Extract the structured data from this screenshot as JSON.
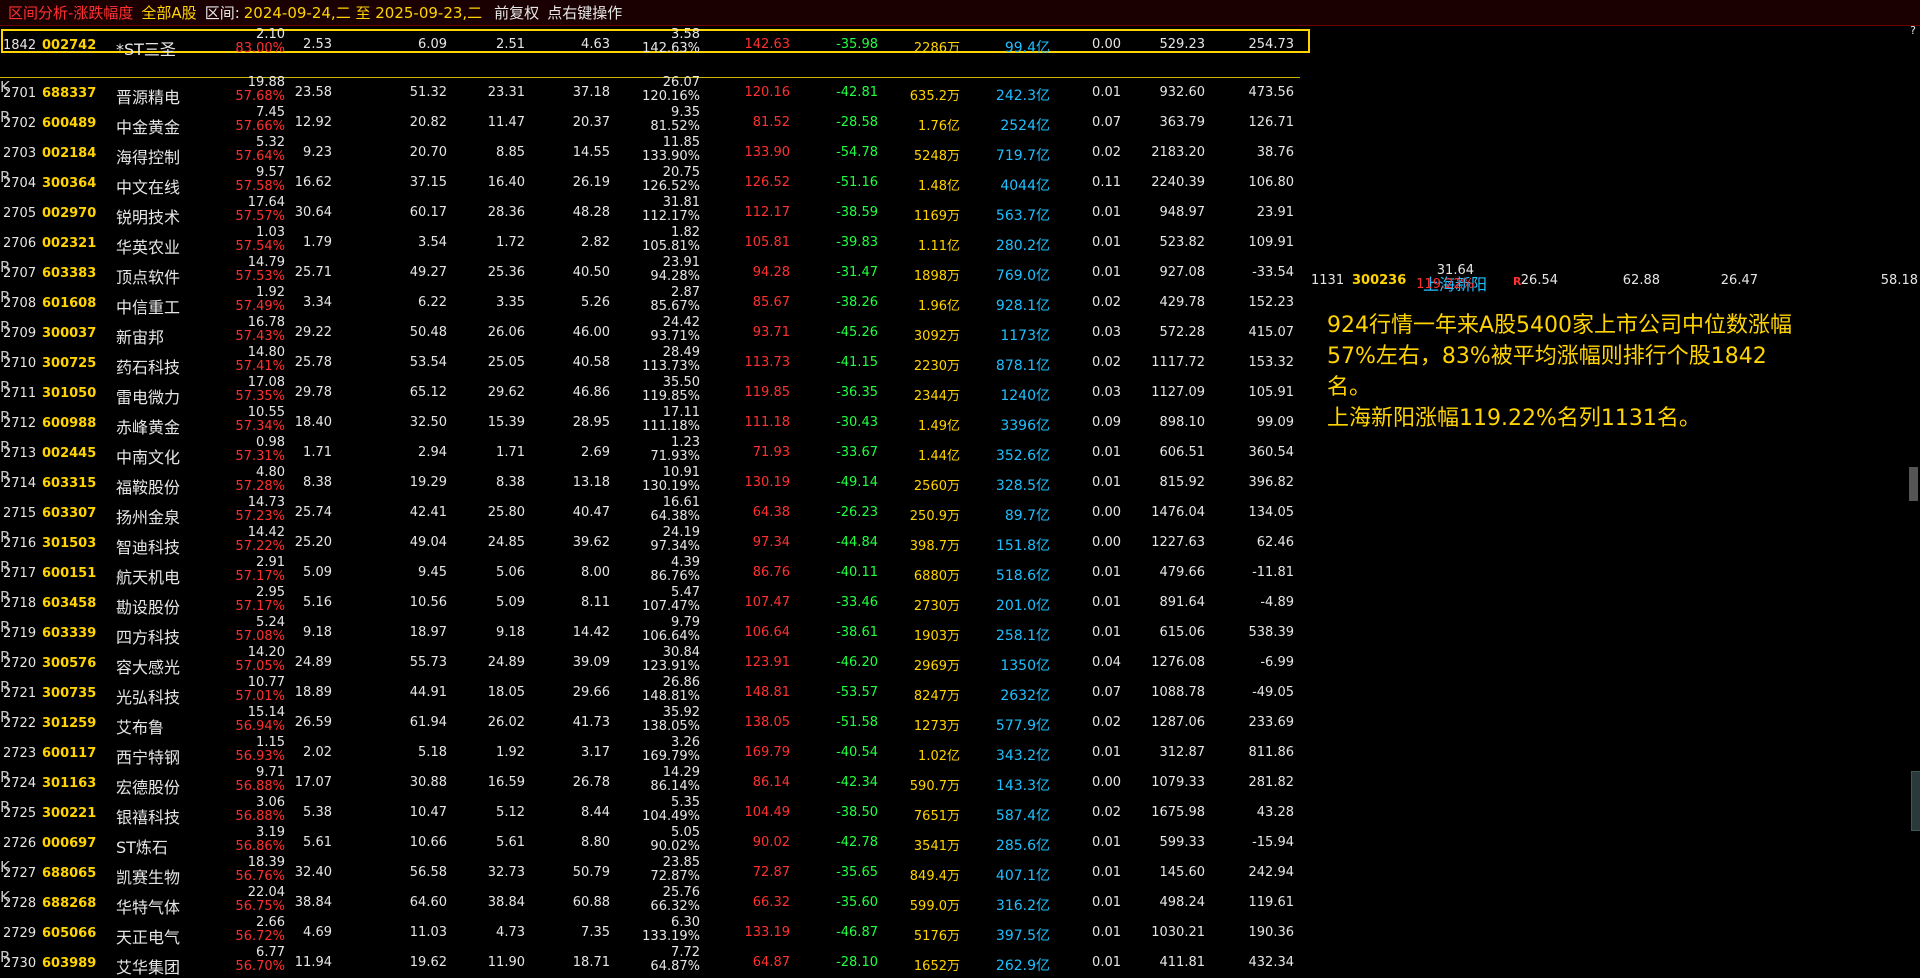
{
  "title": {
    "section": "区间分析-涨跌幅度",
    "market": "全部A股",
    "range_label": "区间:",
    "range": "2024-09-24,二 至 2025-09-23,二",
    "adjust": "前复权",
    "hint": "点右键操作"
  },
  "highlighted": {
    "idx": "1842",
    "code": "002742",
    "name": "*ST三圣",
    "mark": "",
    "p1": "2.10",
    "p1pct": "83.00%",
    "n1": "2.53",
    "n2": "6.09",
    "n3": "2.51",
    "n4": "4.63",
    "p2": "3.58",
    "p2pct": "142.63%",
    "n5": "142.63",
    "n6": "-35.98",
    "n7": "2286万",
    "n8": "99.4亿",
    "n9": "0.00",
    "n10": "529.23",
    "n11": "254.73"
  },
  "rows": [
    {
      "idx": "2701",
      "code": "688337",
      "name": "晋源精电",
      "mark": "K",
      "p1": "19.88",
      "p1pct": "57.68%",
      "n1": "23.58",
      "n2": "51.32",
      "n3": "23.31",
      "n4": "37.18",
      "p2": "26.07",
      "p2pct": "120.16%",
      "n5": "120.16",
      "n6": "-42.81",
      "n7": "635.2万",
      "n8": "242.3亿",
      "n9": "0.01",
      "n10": "932.60",
      "n11": "473.56"
    },
    {
      "idx": "2702",
      "code": "600489",
      "name": "中金黄金",
      "mark": "R",
      "p1": "7.45",
      "p1pct": "57.66%",
      "n1": "12.92",
      "n2": "20.82",
      "n3": "11.47",
      "n4": "20.37",
      "p2": "9.35",
      "p2pct": "81.52%",
      "n5": "81.52",
      "n6": "-28.58",
      "n7": "1.76亿",
      "n8": "2524亿",
      "n9": "0.07",
      "n10": "363.79",
      "n11": "126.71"
    },
    {
      "idx": "2703",
      "code": "002184",
      "name": "海得控制",
      "mark": "",
      "p1": "5.32",
      "p1pct": "57.64%",
      "n1": "9.23",
      "n2": "20.70",
      "n3": "8.85",
      "n4": "14.55",
      "p2": "11.85",
      "p2pct": "133.90%",
      "n5": "133.90",
      "n6": "-54.78",
      "n7": "5248万",
      "n8": "719.7亿",
      "n9": "0.02",
      "n10": "2183.20",
      "n11": "38.76"
    },
    {
      "idx": "2704",
      "code": "300364",
      "name": "中文在线",
      "mark": "R",
      "p1": "9.57",
      "p1pct": "57.58%",
      "n1": "16.62",
      "n2": "37.15",
      "n3": "16.40",
      "n4": "26.19",
      "p2": "20.75",
      "p2pct": "126.52%",
      "n5": "126.52",
      "n6": "-51.16",
      "n7": "1.48亿",
      "n8": "4044亿",
      "n9": "0.11",
      "n10": "2240.39",
      "n11": "106.80"
    },
    {
      "idx": "2705",
      "code": "002970",
      "name": "锐明技术",
      "mark": "",
      "p1": "17.64",
      "p1pct": "57.57%",
      "n1": "30.64",
      "n2": "60.17",
      "n3": "28.36",
      "n4": "48.28",
      "p2": "31.81",
      "p2pct": "112.17%",
      "n5": "112.17",
      "n6": "-38.59",
      "n7": "1169万",
      "n8": "563.7亿",
      "n9": "0.01",
      "n10": "948.97",
      "n11": "23.91"
    },
    {
      "idx": "2706",
      "code": "002321",
      "name": "华英农业",
      "mark": "",
      "p1": "1.03",
      "p1pct": "57.54%",
      "n1": "1.79",
      "n2": "3.54",
      "n3": "1.72",
      "n4": "2.82",
      "p2": "1.82",
      "p2pct": "105.81%",
      "n5": "105.81",
      "n6": "-39.83",
      "n7": "1.11亿",
      "n8": "280.2亿",
      "n9": "0.01",
      "n10": "523.82",
      "n11": "109.91"
    },
    {
      "idx": "2707",
      "code": "603383",
      "name": "顶点软件",
      "mark": "R",
      "p1": "14.79",
      "p1pct": "57.53%",
      "n1": "25.71",
      "n2": "49.27",
      "n3": "25.36",
      "n4": "40.50",
      "p2": "23.91",
      "p2pct": "94.28%",
      "n5": "94.28",
      "n6": "-31.47",
      "n7": "1898万",
      "n8": "769.0亿",
      "n9": "0.01",
      "n10": "927.08",
      "n11": "-33.54"
    },
    {
      "idx": "2708",
      "code": "601608",
      "name": "中信重工",
      "mark": "R",
      "p1": "1.92",
      "p1pct": "57.49%",
      "n1": "3.34",
      "n2": "6.22",
      "n3": "3.35",
      "n4": "5.26",
      "p2": "2.87",
      "p2pct": "85.67%",
      "n5": "85.67",
      "n6": "-38.26",
      "n7": "1.96亿",
      "n8": "928.1亿",
      "n9": "0.02",
      "n10": "429.78",
      "n11": "152.23"
    },
    {
      "idx": "2709",
      "code": "300037",
      "name": "新宙邦",
      "mark": "R",
      "p1": "16.78",
      "p1pct": "57.43%",
      "n1": "29.22",
      "n2": "50.48",
      "n3": "26.06",
      "n4": "46.00",
      "p2": "24.42",
      "p2pct": "93.71%",
      "n5": "93.71",
      "n6": "-45.26",
      "n7": "3092万",
      "n8": "1173亿",
      "n9": "0.03",
      "n10": "572.28",
      "n11": "415.07"
    },
    {
      "idx": "2710",
      "code": "300725",
      "name": "药石科技",
      "mark": "R",
      "p1": "14.80",
      "p1pct": "57.41%",
      "n1": "25.78",
      "n2": "53.54",
      "n3": "25.05",
      "n4": "40.58",
      "p2": "28.49",
      "p2pct": "113.73%",
      "n5": "113.73",
      "n6": "-41.15",
      "n7": "2230万",
      "n8": "878.1亿",
      "n9": "0.02",
      "n10": "1117.72",
      "n11": "153.32"
    },
    {
      "idx": "2711",
      "code": "301050",
      "name": "雷电微力",
      "mark": "R",
      "p1": "17.08",
      "p1pct": "57.35%",
      "n1": "29.78",
      "n2": "65.12",
      "n3": "29.62",
      "n4": "46.86",
      "p2": "35.50",
      "p2pct": "119.85%",
      "n5": "119.85",
      "n6": "-36.35",
      "n7": "2344万",
      "n8": "1240亿",
      "n9": "0.03",
      "n10": "1127.09",
      "n11": "105.91"
    },
    {
      "idx": "2712",
      "code": "600988",
      "name": "赤峰黄金",
      "mark": "R",
      "p1": "10.55",
      "p1pct": "57.34%",
      "n1": "18.40",
      "n2": "32.50",
      "n3": "15.39",
      "n4": "28.95",
      "p2": "17.11",
      "p2pct": "111.18%",
      "n5": "111.18",
      "n6": "-30.43",
      "n7": "1.49亿",
      "n8": "3396亿",
      "n9": "0.09",
      "n10": "898.10",
      "n11": "99.09"
    },
    {
      "idx": "2713",
      "code": "002445",
      "name": "中南文化",
      "mark": "R",
      "p1": "0.98",
      "p1pct": "57.31%",
      "n1": "1.71",
      "n2": "2.94",
      "n3": "1.71",
      "n4": "2.69",
      "p2": "1.23",
      "p2pct": "71.93%",
      "n5": "71.93",
      "n6": "-33.67",
      "n7": "1.44亿",
      "n8": "352.6亿",
      "n9": "0.01",
      "n10": "606.51",
      "n11": "360.54"
    },
    {
      "idx": "2714",
      "code": "603315",
      "name": "福鞍股份",
      "mark": "R",
      "p1": "4.80",
      "p1pct": "57.28%",
      "n1": "8.38",
      "n2": "19.29",
      "n3": "8.38",
      "n4": "13.18",
      "p2": "10.91",
      "p2pct": "130.19%",
      "n5": "130.19",
      "n6": "-49.14",
      "n7": "2560万",
      "n8": "328.5亿",
      "n9": "0.01",
      "n10": "815.92",
      "n11": "396.82"
    },
    {
      "idx": "2715",
      "code": "603307",
      "name": "扬州金泉",
      "mark": "",
      "p1": "14.73",
      "p1pct": "57.23%",
      "n1": "25.74",
      "n2": "42.41",
      "n3": "25.80",
      "n4": "40.47",
      "p2": "16.61",
      "p2pct": "64.38%",
      "n5": "64.38",
      "n6": "-26.23",
      "n7": "250.9万",
      "n8": "89.7亿",
      "n9": "0.00",
      "n10": "1476.04",
      "n11": "134.05"
    },
    {
      "idx": "2716",
      "code": "301503",
      "name": "智迪科技",
      "mark": "R",
      "p1": "14.42",
      "p1pct": "57.22%",
      "n1": "25.20",
      "n2": "49.04",
      "n3": "24.85",
      "n4": "39.62",
      "p2": "24.19",
      "p2pct": "97.34%",
      "n5": "97.34",
      "n6": "-44.84",
      "n7": "398.7万",
      "n8": "151.8亿",
      "n9": "0.00",
      "n10": "1227.63",
      "n11": "62.46"
    },
    {
      "idx": "2717",
      "code": "600151",
      "name": "航天机电",
      "mark": "R",
      "p1": "2.91",
      "p1pct": "57.17%",
      "n1": "5.09",
      "n2": "9.45",
      "n3": "5.06",
      "n4": "8.00",
      "p2": "4.39",
      "p2pct": "86.76%",
      "n5": "86.76",
      "n6": "-40.11",
      "n7": "6880万",
      "n8": "518.6亿",
      "n9": "0.01",
      "n10": "479.66",
      "n11": "-11.81"
    },
    {
      "idx": "2718",
      "code": "603458",
      "name": "勘设股份",
      "mark": "R",
      "p1": "2.95",
      "p1pct": "57.17%",
      "n1": "5.16",
      "n2": "10.56",
      "n3": "5.09",
      "n4": "8.11",
      "p2": "5.47",
      "p2pct": "107.47%",
      "n5": "107.47",
      "n6": "-33.46",
      "n7": "2730万",
      "n8": "201.0亿",
      "n9": "0.01",
      "n10": "891.64",
      "n11": "-4.89"
    },
    {
      "idx": "2719",
      "code": "603339",
      "name": "四方科技",
      "mark": "R",
      "p1": "5.24",
      "p1pct": "57.08%",
      "n1": "9.18",
      "n2": "18.97",
      "n3": "9.18",
      "n4": "14.42",
      "p2": "9.79",
      "p2pct": "106.64%",
      "n5": "106.64",
      "n6": "-38.61",
      "n7": "1903万",
      "n8": "258.1亿",
      "n9": "0.01",
      "n10": "615.06",
      "n11": "538.39"
    },
    {
      "idx": "2720",
      "code": "300576",
      "name": "容大感光",
      "mark": "R",
      "p1": "14.20",
      "p1pct": "57.05%",
      "n1": "24.89",
      "n2": "55.73",
      "n3": "24.89",
      "n4": "39.09",
      "p2": "30.84",
      "p2pct": "123.91%",
      "n5": "123.91",
      "n6": "-46.20",
      "n7": "2969万",
      "n8": "1350亿",
      "n9": "0.04",
      "n10": "1276.08",
      "n11": "-6.99"
    },
    {
      "idx": "2721",
      "code": "300735",
      "name": "光弘科技",
      "mark": "R",
      "p1": "10.77",
      "p1pct": "57.01%",
      "n1": "18.89",
      "n2": "44.91",
      "n3": "18.05",
      "n4": "29.66",
      "p2": "26.86",
      "p2pct": "148.81%",
      "n5": "148.81",
      "n6": "-53.57",
      "n7": "8247万",
      "n8": "2632亿",
      "n9": "0.07",
      "n10": "1088.78",
      "n11": "-49.05"
    },
    {
      "idx": "2722",
      "code": "301259",
      "name": "艾布鲁",
      "mark": "R",
      "p1": "15.14",
      "p1pct": "56.94%",
      "n1": "26.59",
      "n2": "61.94",
      "n3": "26.02",
      "n4": "41.73",
      "p2": "35.92",
      "p2pct": "138.05%",
      "n5": "138.05",
      "n6": "-51.58",
      "n7": "1273万",
      "n8": "577.9亿",
      "n9": "0.02",
      "n10": "1287.06",
      "n11": "233.69"
    },
    {
      "idx": "2723",
      "code": "600117",
      "name": "西宁特钢",
      "mark": "",
      "p1": "1.15",
      "p1pct": "56.93%",
      "n1": "2.02",
      "n2": "5.18",
      "n3": "1.92",
      "n4": "3.17",
      "p2": "3.26",
      "p2pct": "169.79%",
      "n5": "169.79",
      "n6": "-40.54",
      "n7": "1.02亿",
      "n8": "343.2亿",
      "n9": "0.01",
      "n10": "312.87",
      "n11": "811.86"
    },
    {
      "idx": "2724",
      "code": "301163",
      "name": "宏德股份",
      "mark": "R",
      "p1": "9.71",
      "p1pct": "56.88%",
      "n1": "17.07",
      "n2": "30.88",
      "n3": "16.59",
      "n4": "26.78",
      "p2": "14.29",
      "p2pct": "86.14%",
      "n5": "86.14",
      "n6": "-42.34",
      "n7": "590.7万",
      "n8": "143.3亿",
      "n9": "0.00",
      "n10": "1079.33",
      "n11": "281.82"
    },
    {
      "idx": "2725",
      "code": "300221",
      "name": "银禧科技",
      "mark": "R",
      "p1": "3.06",
      "p1pct": "56.88%",
      "n1": "5.38",
      "n2": "10.47",
      "n3": "5.12",
      "n4": "8.44",
      "p2": "5.35",
      "p2pct": "104.49%",
      "n5": "104.49",
      "n6": "-38.50",
      "n7": "7651万",
      "n8": "587.4亿",
      "n9": "0.02",
      "n10": "1675.98",
      "n11": "43.28"
    },
    {
      "idx": "2726",
      "code": "000697",
      "name": "ST炼石",
      "mark": "",
      "p1": "3.19",
      "p1pct": "56.86%",
      "n1": "5.61",
      "n2": "10.66",
      "n3": "5.61",
      "n4": "8.80",
      "p2": "5.05",
      "p2pct": "90.02%",
      "n5": "90.02",
      "n6": "-42.78",
      "n7": "3541万",
      "n8": "285.6亿",
      "n9": "0.01",
      "n10": "599.33",
      "n11": "-15.94"
    },
    {
      "idx": "2727",
      "code": "688065",
      "name": "凯赛生物",
      "mark": "K",
      "p1": "18.39",
      "p1pct": "56.76%",
      "n1": "32.40",
      "n2": "56.58",
      "n3": "32.73",
      "n4": "50.79",
      "p2": "23.85",
      "p2pct": "72.87%",
      "n5": "72.87",
      "n6": "-35.65",
      "n7": "849.4万",
      "n8": "407.1亿",
      "n9": "0.01",
      "n10": "145.60",
      "n11": "242.94"
    },
    {
      "idx": "2728",
      "code": "688268",
      "name": "华特气体",
      "mark": "K",
      "p1": "22.04",
      "p1pct": "56.75%",
      "n1": "38.84",
      "n2": "64.60",
      "n3": "38.84",
      "n4": "60.88",
      "p2": "25.76",
      "p2pct": "66.32%",
      "n5": "66.32",
      "n6": "-35.60",
      "n7": "599.0万",
      "n8": "316.2亿",
      "n9": "0.01",
      "n10": "498.24",
      "n11": "119.61"
    },
    {
      "idx": "2729",
      "code": "605066",
      "name": "天正电气",
      "mark": "",
      "p1": "2.66",
      "p1pct": "56.72%",
      "n1": "4.69",
      "n2": "11.03",
      "n3": "4.73",
      "n4": "7.35",
      "p2": "6.30",
      "p2pct": "133.19%",
      "n5": "133.19",
      "n6": "-46.87",
      "n7": "5176万",
      "n8": "397.5亿",
      "n9": "0.01",
      "n10": "1030.21",
      "n11": "190.36"
    },
    {
      "idx": "2730",
      "code": "603989",
      "name": "艾华集团",
      "mark": "R",
      "p1": "6.77",
      "p1pct": "56.70%",
      "n1": "11.94",
      "n2": "19.62",
      "n3": "11.90",
      "n4": "18.71",
      "p2": "7.72",
      "p2pct": "64.87%",
      "n5": "64.87",
      "n6": "-28.10",
      "n7": "1652万",
      "n8": "262.9亿",
      "n9": "0.01",
      "n10": "411.81",
      "n11": "432.34"
    }
  ],
  "side": {
    "idx": "1131",
    "code": "300236",
    "name": "上海新阳",
    "mark": "R",
    "p1": "31.64",
    "p1pct": "119.22%",
    "n1": "26.54",
    "n2": "62.88",
    "n3": "26.47",
    "n4": "58.18"
  },
  "annotation": {
    "line1": "924行情一年来A股5400家上市公司中位数涨幅57%左右，83%被平均涨幅则排行个股1842名。",
    "line2": "上海新阳涨幅119.22%名列1131名。"
  }
}
